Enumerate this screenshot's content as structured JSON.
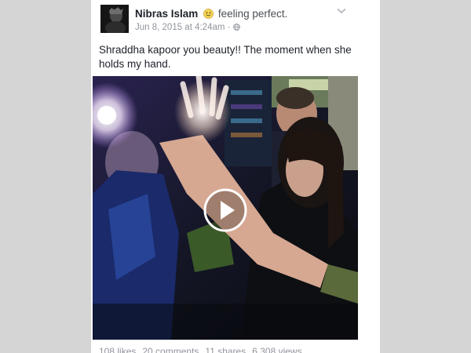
{
  "post": {
    "author": "Nibras Islam",
    "feeling": "feeling perfect.",
    "feeling_icon": "smiling-face-emoji",
    "timestamp": "Jun 8, 2015 at 4:24am",
    "separator": "·",
    "privacy_icon": "globe-icon",
    "text": "Shraddha kapoor you beauty!! The moment when she holds my hand.",
    "video": {
      "play_icon": "play-icon"
    },
    "stats": {
      "likes": "108 likes",
      "comments": "20 comments",
      "shares": "11 shares",
      "views": "6,308 views"
    }
  },
  "colors": {
    "background": "#d5d5d5",
    "card": "#ffffff",
    "name": "#1d2129",
    "meta": "#90949c"
  }
}
